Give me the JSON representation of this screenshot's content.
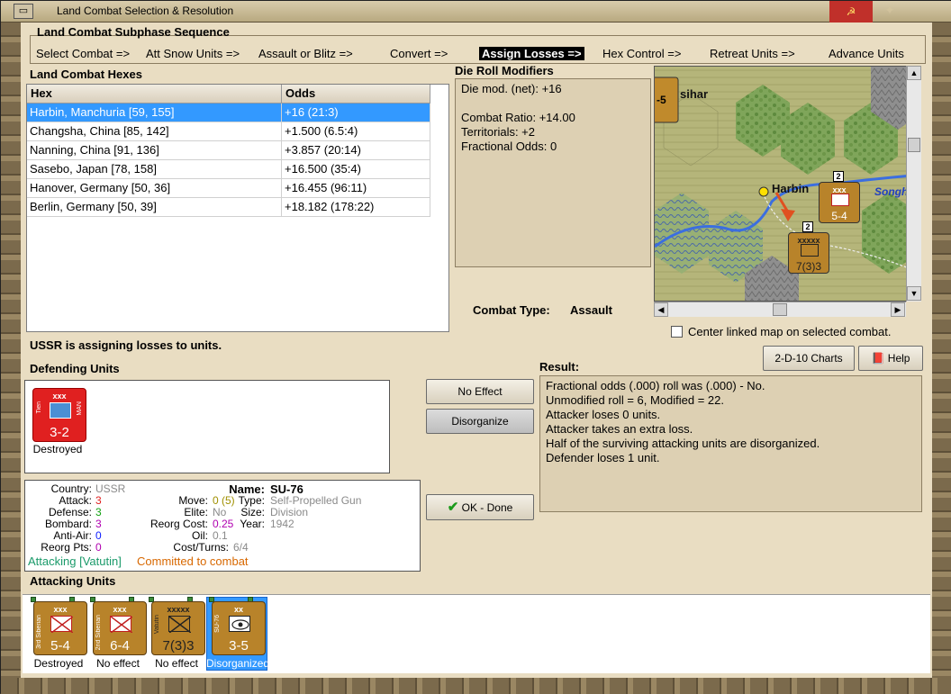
{
  "window": {
    "title": "Land Combat Selection & Resolution",
    "system_glyph": "▭",
    "close_glyph": "☭"
  },
  "sequence": {
    "heading": "Land Combat Subphase Sequence",
    "steps": [
      {
        "label": "Select Combat =>",
        "active": false
      },
      {
        "label": "Att Snow Units =>",
        "active": false
      },
      {
        "label": "Assault or Blitz =>",
        "active": false
      },
      {
        "label": "Convert =>",
        "active": false
      },
      {
        "label": "Assign Losses =>",
        "active": true
      },
      {
        "label": "Hex Control =>",
        "active": false
      },
      {
        "label": "Retreat Units =>",
        "active": false
      },
      {
        "label": "Advance Units",
        "active": false
      }
    ]
  },
  "hexes": {
    "heading": "Land Combat Hexes",
    "columns": [
      "Hex",
      "Odds"
    ],
    "rows": [
      {
        "hex": "Harbin, Manchuria [59, 155]",
        "odds": "+16 (21:3)",
        "selected": true
      },
      {
        "hex": "Changsha, China [85, 142]",
        "odds": "+1.500 (6.5:4)",
        "selected": false
      },
      {
        "hex": "Nanning, China [91, 136]",
        "odds": "+3.857 (20:14)",
        "selected": false
      },
      {
        "hex": "Sasebo, Japan [78, 158]",
        "odds": "+16.500 (35:4)",
        "selected": false
      },
      {
        "hex": "Hanover, Germany [50, 36]",
        "odds": "+16.455 (96:11)",
        "selected": false
      },
      {
        "hex": "Berlin, Germany [50, 39]",
        "odds": "+18.182 (178:22)",
        "selected": false
      }
    ]
  },
  "die_roll": {
    "heading": "Die Roll Modifiers",
    "lines": [
      "Die mod. (net): +16",
      "",
      "Combat Ratio: +14.00",
      "Territorials: +2",
      "Fractional Odds: 0"
    ]
  },
  "map": {
    "city_label": "Harbin",
    "river_label": "Songh",
    "corner_label": "-5",
    "corner_label2": "sihar",
    "units": [
      {
        "side": "3rd Siberian",
        "size": "xxx",
        "strength": "5-4"
      },
      {
        "side": "Vatutin",
        "size": "xxxxx",
        "strength": "7(3)3"
      }
    ],
    "stack_counts": [
      "2",
      "2"
    ]
  },
  "combat_type": {
    "label": "Combat Type:",
    "value": "Assault"
  },
  "center_map": {
    "label": "Center linked map on selected combat.",
    "checked": false
  },
  "status": "USSR is assigning losses to units.",
  "buttons": {
    "charts": "2-D-10 Charts",
    "help": "Help",
    "no_effect": "No Effect",
    "disorganize": "Disorganize",
    "ok_done": "OK - Done"
  },
  "defending": {
    "heading": "Defending Units",
    "units": [
      {
        "size": "xxx",
        "strength": "3-2",
        "side_left": "Tien",
        "side_right": "MAN",
        "caption": "Destroyed",
        "color": "#e02020"
      }
    ]
  },
  "result": {
    "heading": "Result:",
    "lines": [
      "Fractional odds (.000) roll was (.000)  - No.",
      "Unmodified roll = 6, Modified = 22.",
      "Attacker loses 0 units.",
      "Attacker takes an extra loss.",
      "Half of the surviving attacking units are disorganized.",
      "Defender loses 1 unit."
    ]
  },
  "unit_info": {
    "country_label": "Country:",
    "country": "USSR",
    "attack_label": "Attack:",
    "attack": "3",
    "defense_label": "Defense:",
    "defense": "3",
    "bombard_label": "Bombard:",
    "bombard": "3",
    "antiair_label": "Anti-Air:",
    "antiair": "0",
    "reorgpts_label": "Reorg Pts:",
    "reorgpts": "0",
    "move_label": "Move:",
    "move": "0 (5)",
    "elite_label": "Elite:",
    "elite": "No",
    "reorgcost_label": "Reorg Cost:",
    "reorgcost": "0.25",
    "oil_label": "Oil:",
    "oil": "0.1",
    "costturns_label": "Cost/Turns:",
    "costturns": "6/4",
    "name_label": "Name:",
    "name": "SU-76",
    "type_label": "Type:",
    "type": "Self-Propelled Gun",
    "size_label": "Size:",
    "size": "Division",
    "year_label": "Year:",
    "year": "1942",
    "attacking": "Attacking [Vatutin]",
    "committed": "Committed to combat",
    "colors": {
      "attack": "#e02020",
      "defense": "#11a011",
      "bombard": "#b000b0",
      "antiair": "#1020ff",
      "reorgpts": "#b000b0",
      "move": "#a09000",
      "green": "#1a9a6a",
      "orange": "#d86800",
      "gray": "#8a8a8a"
    }
  },
  "attacking": {
    "heading": "Attacking Units",
    "units": [
      {
        "size": "xxx",
        "strength": "5-4",
        "side": "3rd Siberian",
        "caption": "Destroyed",
        "symbol": "infantry",
        "selected": false
      },
      {
        "size": "xxx",
        "strength": "6-4",
        "side": "2nd Siberian",
        "caption": "No effect",
        "symbol": "infantry",
        "selected": false
      },
      {
        "size": "xxxxx",
        "strength": "7(3)3",
        "side": "Vatutin",
        "caption": "No effect",
        "symbol": "hq",
        "selected": false
      },
      {
        "size": "xx",
        "strength": "3-5",
        "side": "SU-76",
        "caption": "Disorganized",
        "symbol": "spg",
        "selected": true
      }
    ]
  }
}
